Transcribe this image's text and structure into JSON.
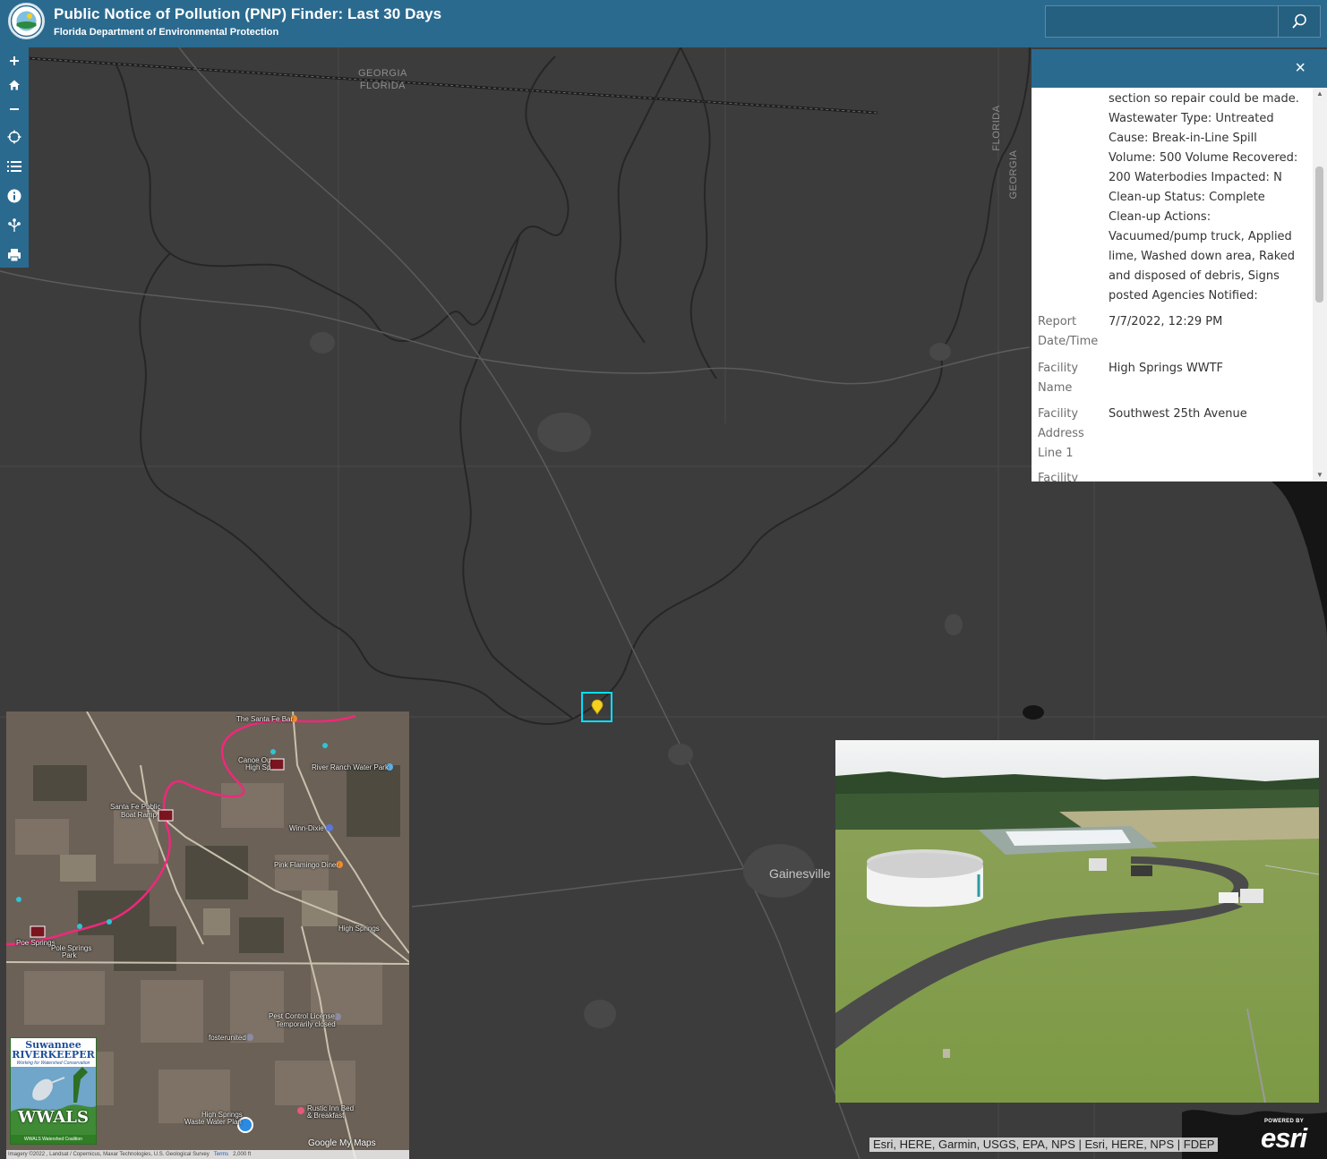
{
  "header": {
    "title": "Public Notice of Pollution (PNP) Finder: Last 30 Days",
    "subtitle": "Florida Department of Environmental Protection",
    "search_value": "",
    "search_icon": "search-icon"
  },
  "toolbar": {
    "tools": [
      "zoom-in-icon",
      "home-icon",
      "zoom-out-icon",
      "locate-icon",
      "layer-list-icon",
      "info-icon",
      "measure-icon",
      "print-icon"
    ]
  },
  "map": {
    "state_line_label_1": "GEORGIA",
    "state_line_label_2": "FLORIDA",
    "state_line_label_vertical_1": "GEORGIA",
    "state_line_label_vertical_2": "FLORIDA",
    "city_label": "Gainesville",
    "marker_color": "#f5d11e",
    "highlight_color": "#00e0ff"
  },
  "popup": {
    "close_label": "×",
    "description_lines": [
      "section so repair could be made.",
      "Wastewater Type: Untreated",
      "Cause: Break-in-Line Spill",
      "Volume: 500 Volume Recovered:",
      "200 Waterbodies Impacted: N",
      "Clean-up Status: Complete",
      "Clean-up Actions:",
      "Vacuumed/pump truck, Applied",
      "lime, Washed down area, Raked",
      "and disposed of debris, Signs",
      "posted Agencies Notified:"
    ],
    "attributes": [
      {
        "label_lines": [
          "Report",
          "Date/Time"
        ],
        "value": "7/7/2022, 12:29 PM"
      },
      {
        "label_lines": [
          "Facility",
          "Name"
        ],
        "value": "High Springs WWTF"
      },
      {
        "label_lines": [
          "Facility",
          "Address",
          "Line 1"
        ],
        "value": "Southwest 25th Avenue"
      },
      {
        "label_lines": [
          "Facility"
        ],
        "value": ""
      }
    ]
  },
  "inset_map": {
    "labels": [
      "The Santa Fe Bar",
      "Canoe Ou",
      "High Sp",
      "River Ranch Water Park",
      "Santa Fe Public",
      "Boat Ramp",
      "Winn-Dixie",
      "Pink Flamingo Diner",
      "High Springs",
      "Poe Springs",
      "Pole Springs",
      "Park",
      "Pest Control License",
      "Temporarily closed",
      "fosterunited",
      "High Springs",
      "Waste Water Plan",
      "Rustic Inn Bed",
      "& Breakfast"
    ],
    "google_logo": "Google",
    "my_maps": "My Maps",
    "footer": "Imagery ©2022 , Landsat / Copernicus, Maxar Technologies, U.S. Geological Survey",
    "footer_terms": "Terms",
    "footer_scale": "2,000 ft",
    "riverkeeper": {
      "title_1": "Suwannee",
      "title_2": "RIVERKEEPER",
      "tagline": "Working for Watershed Conservation",
      "wwals": "WWALS",
      "coalition": "WWALS Watershed Coalition"
    }
  },
  "attribution": "Esri, HERE, Garmin, USGS, EPA, NPS | Esri, HERE, NPS | FDEP",
  "esri": {
    "powered_by": "POWERED BY",
    "wordmark": "esri"
  }
}
